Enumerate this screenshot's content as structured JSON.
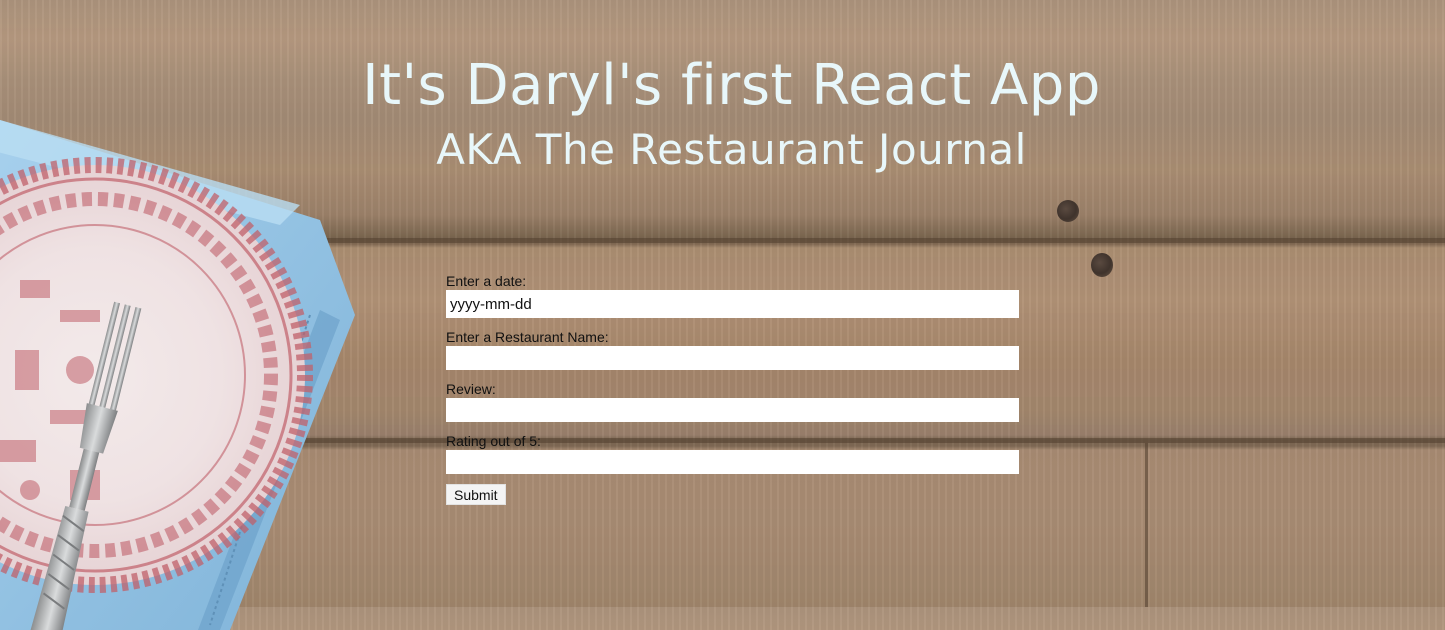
{
  "header": {
    "title": "It's Daryl's first React App",
    "subtitle": "AKA The Restaurant Journal"
  },
  "form": {
    "date_label": "Enter a date:",
    "date_placeholder": "yyyy-mm-dd",
    "restaurant_label": "Enter a Restaurant Name:",
    "restaurant_value": "",
    "review_label": "Review:",
    "review_value": "",
    "rating_label": "Rating out of 5:",
    "rating_value": "",
    "submit_label": "Submit"
  },
  "colors": {
    "heading_text": "#e8f7fa",
    "napkin": "#8fc1e3",
    "plate_pattern": "#c0606a"
  }
}
